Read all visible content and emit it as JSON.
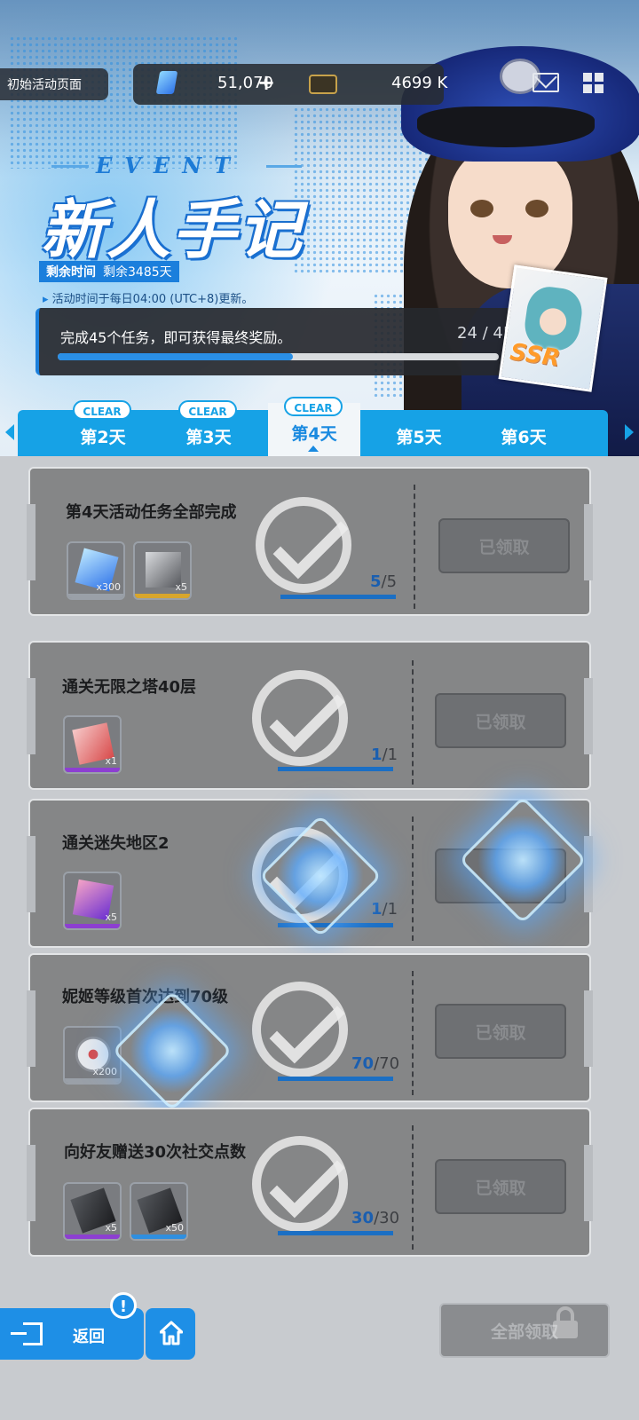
{
  "header": {
    "page_button": "初始活动页面",
    "gem_amount": "51,070",
    "gem_plus": "+",
    "credit_amount": "4699 K"
  },
  "event": {
    "label": "EVENT",
    "title": "新人手记",
    "remaining_label": "剩余时间",
    "remaining_value": "剩余3485天",
    "refresh_note": "活动时间于每日04:00 (UTC+8)更新。",
    "goal_text": "完成45个任务，即可获得最终奖励。",
    "progress_current": 24,
    "progress_total": 45,
    "progress_text": "24 / 45",
    "reward_card": "SSR"
  },
  "tabs": [
    {
      "label": "第2天",
      "badge": "CLEAR"
    },
    {
      "label": "第3天",
      "badge": "CLEAR"
    },
    {
      "label": "第4天",
      "badge": "CLEAR",
      "active": true
    },
    {
      "label": "第5天",
      "badge": ""
    },
    {
      "label": "第6天",
      "badge": ""
    }
  ],
  "tasks": [
    {
      "title": "第4天活动任务全部完成",
      "progress": "5",
      "total": "5",
      "button": "已领取",
      "items": [
        {
          "qty": "x300",
          "rarity": "#9aa0a8"
        },
        {
          "qty": "x5",
          "rarity": "#d8a62c"
        }
      ]
    },
    {
      "title": "通关无限之塔40层",
      "progress": "1",
      "total": "1",
      "button": "已领取",
      "items": [
        {
          "qty": "x1",
          "rarity": "#8d3fd1"
        }
      ]
    },
    {
      "title": "通关迷失地区2",
      "progress": "1",
      "total": "1",
      "button": "已领取",
      "items": [
        {
          "qty": "x5",
          "rarity": "#8d3fd1"
        }
      ]
    },
    {
      "title": "妮姬等级首次达到70级",
      "progress": "70",
      "total": "70",
      "button": "已领取",
      "items": [
        {
          "qty": "x200",
          "rarity": "#9aa0a8"
        }
      ]
    },
    {
      "title": "向好友赠送30次社交点数",
      "progress": "30",
      "total": "30",
      "button": "已领取",
      "items": [
        {
          "qty": "x5",
          "rarity": "#8d3fd1"
        },
        {
          "qty": "x50",
          "rarity": "#2f8fe0"
        }
      ]
    }
  ],
  "footer": {
    "back_label": "返回",
    "alert_mark": "!",
    "claim_all_label": "全部领取"
  },
  "colors": {
    "accent": "#16a2e6",
    "progress_blue": "#2a8fe6",
    "card_bg": "#858687"
  }
}
